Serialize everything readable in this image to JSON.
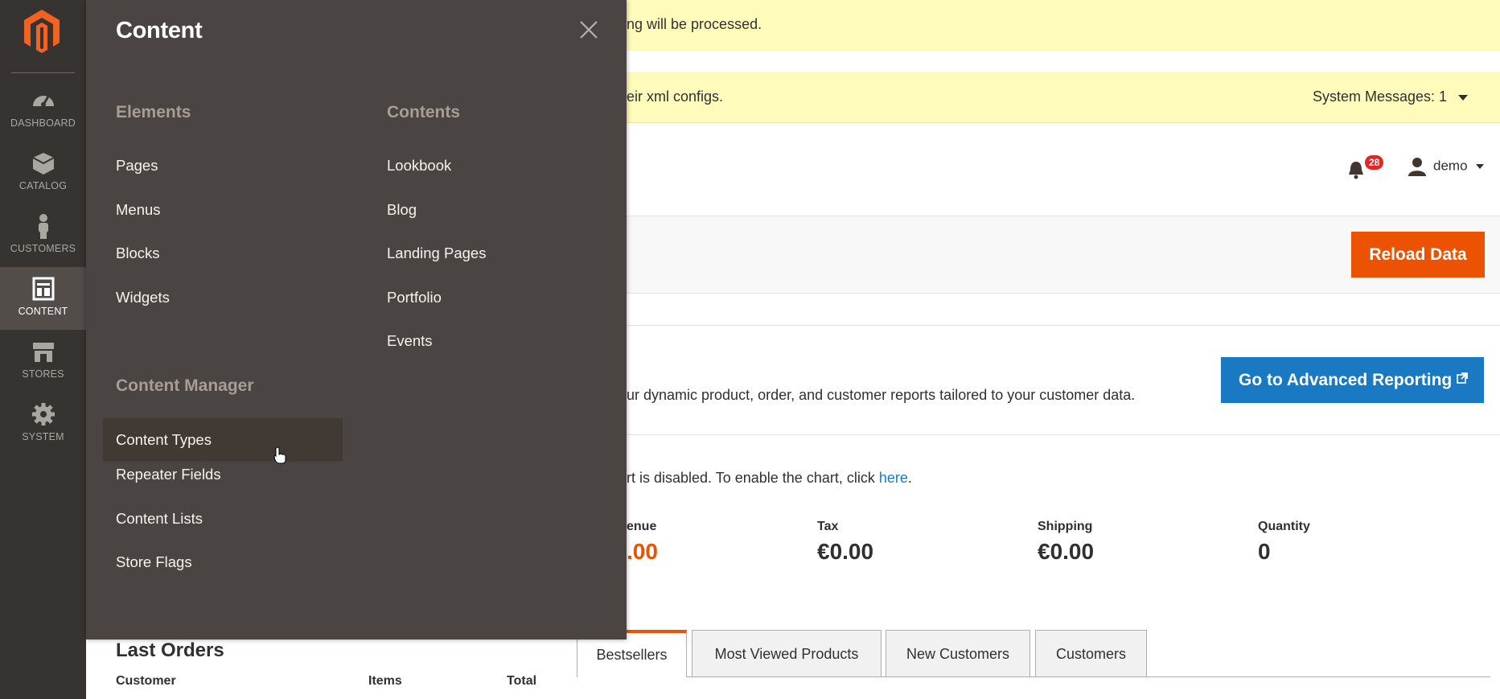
{
  "nav": {
    "logo": "magento-logo-icon",
    "items": [
      {
        "label": "DASHBOARD",
        "icon": "dashboard-icon"
      },
      {
        "label": "CATALOG",
        "icon": "catalog-icon"
      },
      {
        "label": "CUSTOMERS",
        "icon": "customers-icon"
      },
      {
        "label": "CONTENT",
        "icon": "content-icon",
        "active": true
      },
      {
        "label": "STORES",
        "icon": "stores-icon"
      },
      {
        "label": "SYSTEM",
        "icon": "system-icon"
      }
    ]
  },
  "flyout": {
    "title": "Content",
    "elements": {
      "heading": "Elements",
      "links": [
        "Pages",
        "Menus",
        "Blocks",
        "Widgets"
      ]
    },
    "content_manager": {
      "heading": "Content Manager",
      "links": [
        "Content Types",
        "Repeater Fields",
        "Content Lists",
        "Store Flags"
      ]
    },
    "contents": {
      "heading": "Contents",
      "links": [
        "Lookbook",
        "Blog",
        "Landing Pages",
        "Portfolio",
        "Events"
      ]
    }
  },
  "messages": {
    "msg1": "ng will be processed.",
    "msg2": "eir xml configs.",
    "system_messages": "System Messages: 1"
  },
  "header": {
    "notifications_count": "28",
    "user": "demo"
  },
  "actions": {
    "reload": "Reload Data"
  },
  "advanced_reporting": {
    "text": "ur dynamic product, order, and customer reports tailored to your customer data.",
    "button": "Go to Advanced Reporting"
  },
  "chart_note": {
    "text": "rt is disabled. To enable the chart, click ",
    "link": "here",
    "suffix": "."
  },
  "totals": [
    {
      "label": "enue",
      "value": ".00"
    },
    {
      "label": "Tax",
      "value": "€0.00"
    },
    {
      "label": "Shipping",
      "value": "€0.00"
    },
    {
      "label": "Quantity",
      "value": "0"
    }
  ],
  "last_orders": {
    "title": "Last Orders",
    "columns": [
      "Customer",
      "Items",
      "Total"
    ]
  },
  "tabs": [
    "Bestsellers",
    "Most Viewed Products",
    "New Customers",
    "Customers"
  ],
  "colors": {
    "nav_bg": "#373330",
    "flyout_bg": "#4a4542",
    "accent_orange": "#eb5202",
    "link_blue": "#1979c3",
    "message_yellow": "#fffbbb"
  }
}
